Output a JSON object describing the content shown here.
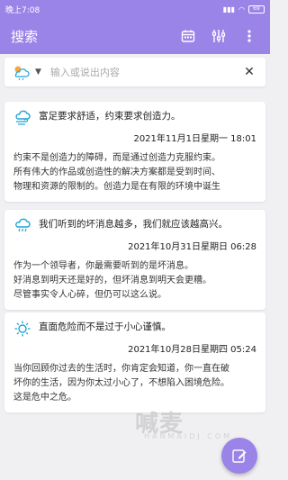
{
  "statusbar": {
    "time": "晚上7:08",
    "battery": "69"
  },
  "appbar": {
    "title": "搜索"
  },
  "search": {
    "placeholder": "输入或说出内容"
  },
  "entries": [
    {
      "weather_icon": "cloud-wind-icon",
      "headline": "富足要求舒适，约束要求创造力。",
      "date": "2021年11月1日星期一 18:01",
      "body": [
        "约束不是创造力的障碍，而是通过创造力克服约束。",
        "所有伟大的作品或创造性的解决方案都是受到时间、",
        "物理和资源的限制的。创造力是在有限的环境中诞生"
      ]
    },
    {
      "weather_icon": "cloud-rain-icon",
      "headline": "我们听到的坏消息越多，我们就应该越高兴。",
      "date": "2021年10月31日星期日 06:28",
      "body": [
        "作为一个领导者，你最需要听到的是坏消息。",
        "好消息到明天还是好的，但坏消息到明天会更糟。",
        "尽管事实令人心碎，但仍可以这么说。"
      ]
    },
    {
      "weather_icon": "sun-icon",
      "headline": "直面危险而不是过于小心谨慎。",
      "date": "2021年10月28日星期四 05:24",
      "body": [
        "当你回顾你过去的生活时，你肯定会知道，你一直在破",
        "坏你的生活，因为你太过小心了，不想陷入困境危险。",
        "这是危中之危。"
      ]
    }
  ],
  "watermark": {
    "text": "喊麦",
    "sub": "HANMAIDJ.COM"
  },
  "colors": {
    "primary": "#9b84e8",
    "icon_blue": "#1fa3d6"
  }
}
